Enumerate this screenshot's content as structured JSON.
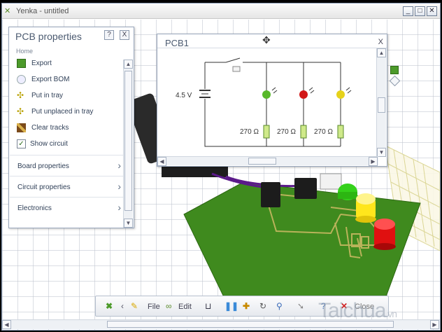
{
  "window": {
    "title": "Yenka - untitled",
    "controls": [
      "minimize-icon",
      "maximize-icon",
      "close-icon"
    ]
  },
  "props_panel": {
    "title": "PCB properties",
    "help": "?",
    "close": "X",
    "breadcrumb": "Home",
    "actions": [
      {
        "label": "Export",
        "icon": "export-icon"
      },
      {
        "label": "Export BOM",
        "icon": "bom-icon"
      },
      {
        "label": "Put in tray",
        "icon": "tray-icon"
      },
      {
        "label": "Put unplaced in tray",
        "icon": "tray-icon"
      },
      {
        "label": "Clear tracks",
        "icon": "clear-tracks-icon"
      },
      {
        "label": "Show circuit",
        "icon": "checkbox-icon",
        "checked": true
      }
    ],
    "sections": [
      "Board properties",
      "Circuit properties",
      "Electronics"
    ]
  },
  "pcb1_window": {
    "title": "PCB1",
    "close": "X",
    "battery_label": "4.5 V",
    "resistor_labels": [
      "270 Ω",
      "270 Ω",
      "270 Ω"
    ],
    "led_colors": [
      "#58b82a",
      "#d21818",
      "#e6d21a"
    ]
  },
  "toolbar": {
    "file_label": "File",
    "edit_label": "Edit",
    "close_label": "Close"
  },
  "watermark": {
    "text": "Taichua",
    "tld": ".vn"
  },
  "colors": {
    "board_green": "#3f8a1e",
    "trace": "#b9b35a",
    "led_green": "#34d11a",
    "led_yellow": "#ffe61c",
    "led_red": "#e01010"
  }
}
